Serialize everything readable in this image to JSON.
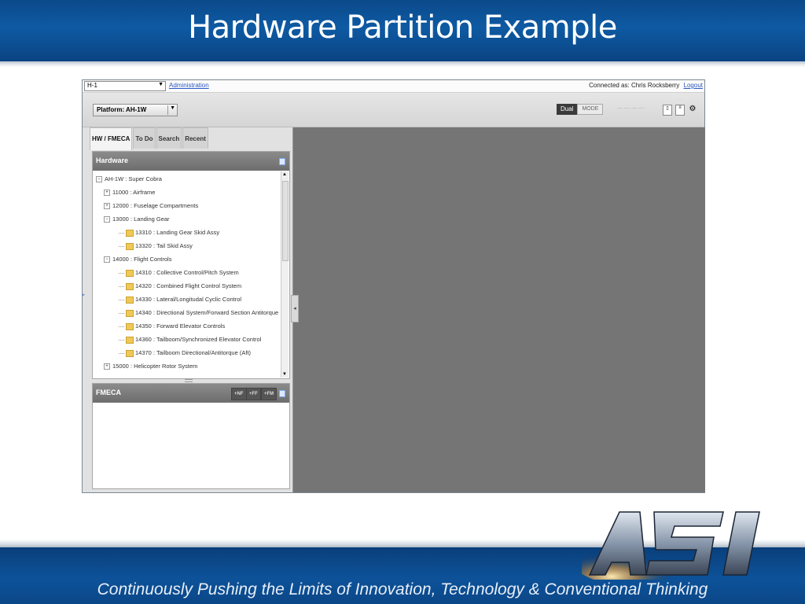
{
  "slide": {
    "title": "Hardware Partition Example",
    "tagline": "Continuously Pushing the Limits of  Innovation, Technology & Conventional Thinking",
    "logo_text": "ASI"
  },
  "app": {
    "topbar": {
      "selector_value": "H-1",
      "admin_link": "Administration",
      "connected_label": "Connected as: Chris Rocksberry",
      "logout_link": "Logout"
    },
    "toolbar": {
      "platform_value": "Platform: AH-1W",
      "mode_dual": "Dual",
      "mode_label": "MODE"
    },
    "tabs": [
      "HW / FMECA",
      "To Do",
      "Search",
      "Recent"
    ],
    "hardware_panel": {
      "title": "Hardware",
      "tree": [
        {
          "label": "AH-1W : Super Cobra",
          "level": 0,
          "type": "root",
          "state": "expanded"
        },
        {
          "label": "11000 : Airframe",
          "level": 1,
          "type": "branch",
          "state": "collapsed"
        },
        {
          "label": "12000 : Fuselage Compartments",
          "level": 1,
          "type": "branch",
          "state": "collapsed"
        },
        {
          "label": "13000 : Landing Gear",
          "level": 1,
          "type": "branch",
          "state": "expanded"
        },
        {
          "label": "13310 : Landing Gear Skid Assy",
          "level": 2,
          "type": "leaf"
        },
        {
          "label": "13320 : Tail Skid Assy",
          "level": 2,
          "type": "leaf"
        },
        {
          "label": "14000 : Flight Controls",
          "level": 1,
          "type": "branch",
          "state": "expanded"
        },
        {
          "label": "14310 : Collective Control/Pitch System",
          "level": 2,
          "type": "leaf"
        },
        {
          "label": "14320 : Combined Flight Control System",
          "level": 2,
          "type": "leaf"
        },
        {
          "label": "14330 : Lateral/Longitudal Cyclic Control",
          "level": 2,
          "type": "leaf"
        },
        {
          "label": "14340 : Directional System/Forward Section Antitorque",
          "level": 2,
          "type": "leaf"
        },
        {
          "label": "14350 : Forward Elevator Controls",
          "level": 2,
          "type": "leaf"
        },
        {
          "label": "14360 : Tailboom/Synchronized Elevator Control",
          "level": 2,
          "type": "leaf"
        },
        {
          "label": "14370 : Tailboom Directional/Antitorque (Aft)",
          "level": 2,
          "type": "leaf"
        },
        {
          "label": "15000 : Helicopter Rotor System",
          "level": 1,
          "type": "branch",
          "state": "collapsed"
        }
      ]
    },
    "fmeca_panel": {
      "title": "FMECA",
      "buttons": [
        "+NF",
        "+FF",
        "+FM"
      ]
    },
    "colors": {
      "slide_blue": "#0e5aa3",
      "panel_header": "#7a7a7a",
      "content_gray": "#757575",
      "link_blue": "#2b59c3"
    }
  }
}
